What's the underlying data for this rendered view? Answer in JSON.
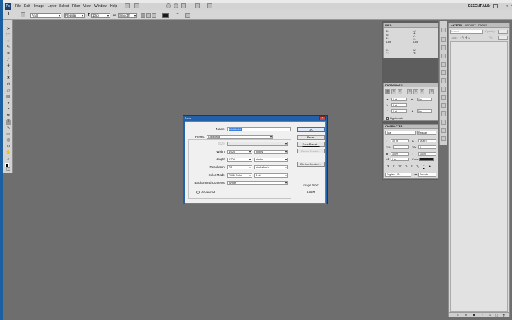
{
  "menu": {
    "items": [
      "File",
      "Edit",
      "Image",
      "Layer",
      "Select",
      "Filter",
      "View",
      "Window",
      "Help"
    ],
    "workspace": "ESSENTIALS"
  },
  "options": {
    "font_family": "Arial",
    "font_style": "Regular",
    "font_size": "10 pt",
    "aa_label": "aa",
    "anti_alias": "Smooth"
  },
  "info_panel": {
    "title": "INFO",
    "r": "R:",
    "g": "G:",
    "b": "B:",
    "c": "C:",
    "m": "M:",
    "y": "Y:",
    "k": "K:",
    "bit1": "8-bit",
    "bit2": "8-bit",
    "x": "X:",
    "yc": "Y:",
    "w": "W:",
    "h": "H:"
  },
  "paragraph_panel": {
    "title": "PARAGRAPH",
    "indent_left": "0 pt",
    "indent_right": "0 pt",
    "first_line": "0 pt",
    "space_before": "0 pt",
    "space_after": "0 pt",
    "hyphenate_label": "Hyphenate"
  },
  "character_panel": {
    "title": "CHARACTER",
    "font_family": "Arial",
    "font_style": "Regular",
    "size": "10 pt",
    "leading": "(Auto)",
    "kerning": "",
    "tracking": "0",
    "vscale": "100%",
    "hscale": "100%",
    "baseline": "0 pt",
    "color_label": "Color:",
    "style_buttons": [
      "T",
      "T",
      "TT",
      "Tr",
      "T¹",
      "T₁",
      "T",
      "T"
    ],
    "language": "English: USA",
    "aa_label": "aa",
    "anti_alias": "Smooth"
  },
  "layers_panel": {
    "tabs": [
      "LAYERS",
      "HISTORY",
      "PATHS"
    ],
    "blend_mode": "Normal",
    "opacity_label": "Opacity:",
    "lock_label": "Lock:",
    "fill_label": "Fill:"
  },
  "dialog": {
    "title": "New",
    "name_label": "Name:",
    "name_value": "Untitled-1",
    "preset_label": "Preset:",
    "preset_value": "Clipboard",
    "size_label": "Size:",
    "width_label": "Width:",
    "width_value": "1928",
    "width_unit": "pixels",
    "height_label": "Height:",
    "height_value": "1208",
    "height_unit": "pixels",
    "resolution_label": "Resolution:",
    "resolution_value": "72",
    "resolution_unit": "pixels/inch",
    "color_mode_label": "Color Mode:",
    "color_mode_value": "RGB Color",
    "bit_depth": "8 bit",
    "background_label": "Background Contents:",
    "background_value": "White",
    "advanced_label": "Advanced",
    "ok": "OK",
    "reset": "Reset",
    "save_preset": "Save Preset...",
    "delete_preset": "Delete Preset...",
    "device_central": "Device Central...",
    "image_size_label": "Image Size:",
    "image_size_value": "6.66M"
  },
  "colors": {
    "workspace": "#6e6e6e",
    "title_blue": "#2460a8",
    "selection": "#3d7fd6"
  }
}
